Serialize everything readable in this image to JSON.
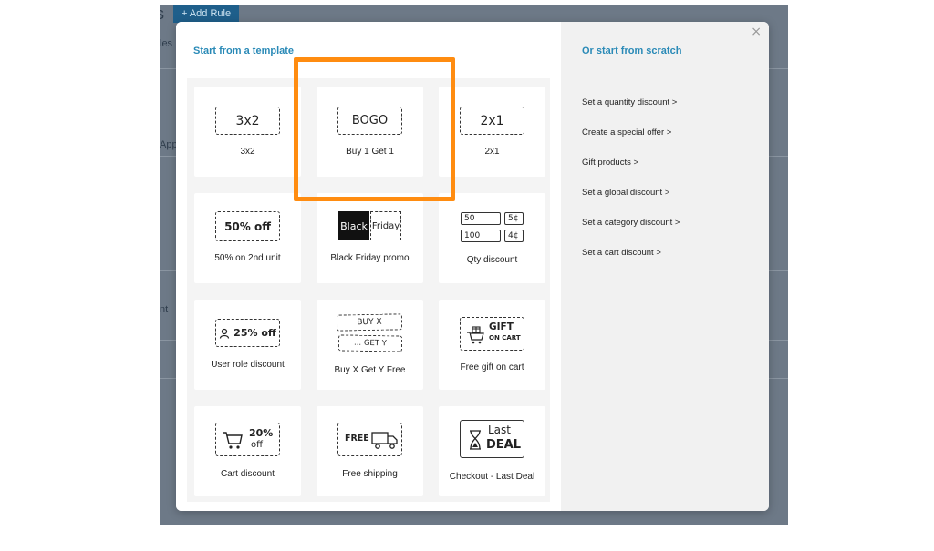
{
  "background": {
    "heading_fragment": "s",
    "add_rule_label": "+ Add Rule",
    "fragment_1": "les",
    "fragment_2": "Appl",
    "fragment_3": "nt"
  },
  "modal": {
    "left_title": "Start from a template",
    "right_title": "Or start from scratch",
    "close_glyph": "×"
  },
  "templates": [
    {
      "badge": "3x2",
      "label": "3x2"
    },
    {
      "badge": "BOGO",
      "label": "Buy 1 Get 1"
    },
    {
      "badge": "2x1",
      "label": "2x1"
    },
    {
      "badge": "50% off",
      "label": "50% on 2nd unit"
    },
    {
      "badge_left": "Black",
      "badge_right": "Friday",
      "label": "Black Friday promo"
    },
    {
      "qty_rows": [
        [
          "50",
          "5¢"
        ],
        [
          "100",
          "4¢"
        ]
      ],
      "label": "Qty discount"
    },
    {
      "badge": "25% off",
      "icon": "user-icon",
      "label": "User role discount"
    },
    {
      "badge_top": "BUY X",
      "badge_bottom": "... GET Y",
      "label": "Buy X Get Y Free"
    },
    {
      "badge_top": "GIFT",
      "badge_bottom": "ON CART",
      "icon": "gift-cart-icon",
      "label": "Free gift on cart"
    },
    {
      "badge_top": "20%",
      "badge_bottom": "off",
      "icon": "cart-icon",
      "label": "Cart discount"
    },
    {
      "badge": "FREE",
      "icon": "truck-icon",
      "label": "Free shipping"
    },
    {
      "badge_top": "Last",
      "badge_bottom": "DEAL",
      "icon": "hourglass-icon",
      "label": "Checkout - Last Deal"
    }
  ],
  "scratch_links": [
    "Set a quantity discount >",
    "Create a special offer >",
    "Gift products >",
    "Set a global discount >",
    "Set a category discount >",
    "Set a cart discount >"
  ],
  "colors": {
    "accent": "#2a8ab7",
    "highlight": "#ff8c10",
    "backdrop": "#6d7987",
    "right_panel": "#f1f1f1"
  }
}
